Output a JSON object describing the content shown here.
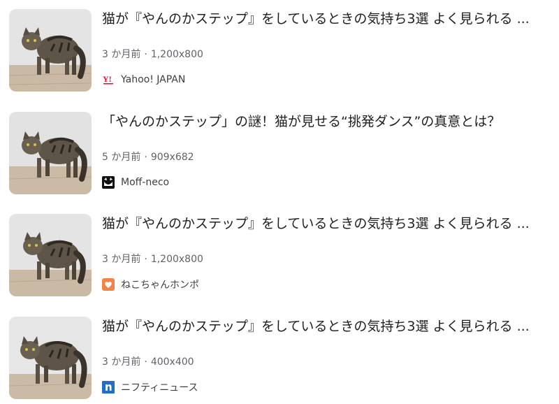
{
  "results": [
    {
      "title": "猫が『やんのかステップ』をしているときの気持ち3選 よく見られる ...",
      "age": "3 か月前",
      "dimensions": "1,200x800",
      "source": "Yahoo! JAPAN",
      "favicon": "yahoo-japan-icon"
    },
    {
      "title": "「やんのかステップ」の謎！猫が見せる“挑発ダンス”の真意とは？",
      "age": "5 か月前",
      "dimensions": "909x682",
      "source": "Moff-neco",
      "favicon": "moff-neco-icon"
    },
    {
      "title": "猫が『やんのかステップ』をしているときの気持ち3選 よく見られる ...",
      "age": "3 か月前",
      "dimensions": "1,200x800",
      "source": "ねこちゃんホンポ",
      "favicon": "nekochan-honpo-icon"
    },
    {
      "title": "猫が『やんのかステップ』をしているときの気持ち3選 よく見られる ...",
      "age": "3 か月前",
      "dimensions": "400x400",
      "source": "ニフティニュース",
      "favicon": "nifty-news-icon"
    }
  ],
  "meta_separator": "·",
  "colors": {
    "title": "#202124",
    "meta": "#5f6368",
    "yahoo_red": "#ff0033",
    "honpo_orange": "#f0854a",
    "nifty_blue": "#1f6fc5"
  }
}
